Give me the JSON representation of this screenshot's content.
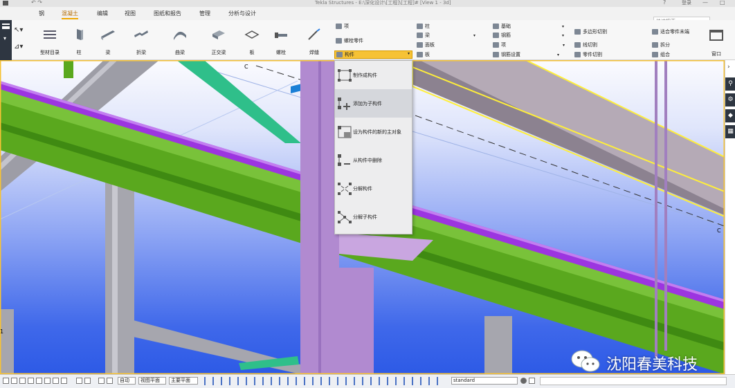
{
  "titlebar": {
    "text": "Tekla Structures - E:\\深化设计\\[工程]\\[工程]#  [View 1 - 3d]",
    "help": "?",
    "user": "登录"
  },
  "menu": {
    "items": [
      {
        "label": "钢"
      },
      {
        "label": "混凝土"
      },
      {
        "label": "编辑"
      },
      {
        "label": "视图"
      },
      {
        "label": "图纸和报告"
      },
      {
        "label": "管理"
      },
      {
        "label": "分析与设计"
      }
    ],
    "search_placeholder": "快速搜索"
  },
  "toolbar": {
    "large_buttons": [
      {
        "label": "型材目录",
        "icon": "profile-catalog-icon"
      },
      {
        "label": "柱",
        "icon": "column-icon"
      },
      {
        "label": "梁",
        "icon": "beam-icon"
      },
      {
        "label": "折梁",
        "icon": "polybeam-icon"
      },
      {
        "label": "曲梁",
        "icon": "curved-beam-icon"
      },
      {
        "label": "正交梁",
        "icon": "orthogonal-beam-icon"
      },
      {
        "label": "板",
        "icon": "plate-icon"
      },
      {
        "label": "螺栓",
        "icon": "bolt-icon"
      },
      {
        "label": "焊缝",
        "icon": "weld-icon"
      }
    ],
    "group1": [
      {
        "label": "项"
      },
      {
        "label": "螺栓零件"
      },
      {
        "label": "构件"
      }
    ],
    "group2": [
      {
        "label": "柱"
      },
      {
        "label": "梁"
      },
      {
        "label": "面板"
      },
      {
        "label": "板"
      }
    ],
    "group3": [
      {
        "label": "基础"
      },
      {
        "label": "钢筋"
      },
      {
        "label": "项"
      },
      {
        "label": "钢筋设置"
      }
    ],
    "group4": [
      {
        "label": "多边形切割"
      },
      {
        "label": "线切割"
      },
      {
        "label": "零件切割"
      }
    ],
    "group5": [
      {
        "label": "适合零件末端"
      },
      {
        "label": "拆分"
      },
      {
        "label": "组合"
      }
    ],
    "window_label": "窗口"
  },
  "dropdown": {
    "items": [
      {
        "label": "制作成构件"
      },
      {
        "label": "添加为子构件"
      },
      {
        "label": "设为构件的新的主对象"
      },
      {
        "label": "从构件中删除"
      },
      {
        "label": "分解构件"
      },
      {
        "label": "分解子构件"
      }
    ]
  },
  "viewport": {
    "labels": {
      "c_top": "C",
      "c_right": "C",
      "one_left": "1"
    }
  },
  "statusbar": {
    "selects": [
      "自动",
      "视图平面",
      "主要平面"
    ],
    "profile": "standard"
  },
  "watermark": {
    "text": "沈阳春美科技"
  },
  "colors": {
    "accent": "#f0a700",
    "beam_green": "#5aa81e",
    "purple_member": "#b18ad0",
    "teal_member": "#2fbf8a",
    "violet_pipe": "#9c35e0",
    "grey_frame": "#a4a4ac"
  }
}
